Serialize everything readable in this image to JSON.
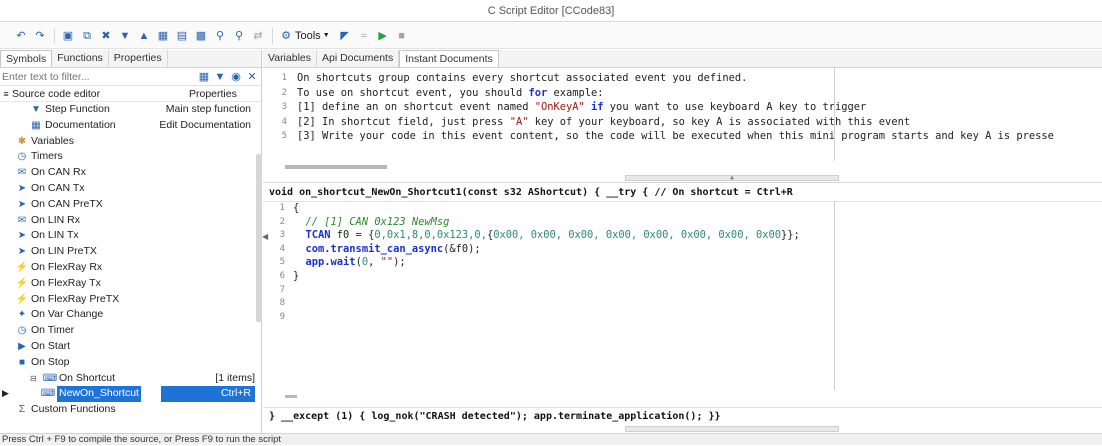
{
  "window": {
    "title": "C Script Editor [CCode83]"
  },
  "toolbar": {
    "tools_label": "Tools"
  },
  "left_tabs": [
    "Symbols",
    "Functions",
    "Properties"
  ],
  "filter": {
    "placeholder": "Enter text to filter..."
  },
  "tree_header": {
    "name": "Source code editor",
    "value": "Properties"
  },
  "tree": [
    {
      "label": "Step Function",
      "value": "Main step function",
      "icon": "step-function-icon"
    },
    {
      "label": "Documentation",
      "value": "Edit Documentation",
      "icon": "documentation-icon"
    },
    {
      "label": "Variables",
      "value": "",
      "icon": "variables-icon"
    },
    {
      "label": "Timers",
      "value": "",
      "icon": "timer-icon"
    },
    {
      "label": "On CAN Rx",
      "value": "",
      "icon": "envelope-icon"
    },
    {
      "label": "On CAN Tx",
      "value": "",
      "icon": "send-icon"
    },
    {
      "label": "On CAN PreTX",
      "value": "",
      "icon": "send-icon"
    },
    {
      "label": "On LIN Rx",
      "value": "",
      "icon": "envelope-icon"
    },
    {
      "label": "On LIN Tx",
      "value": "",
      "icon": "send-icon"
    },
    {
      "label": "On LIN PreTX",
      "value": "",
      "icon": "send-icon"
    },
    {
      "label": "On FlexRay Rx",
      "value": "",
      "icon": "flexray-icon"
    },
    {
      "label": "On FlexRay Tx",
      "value": "",
      "icon": "flexray-icon"
    },
    {
      "label": "On FlexRay PreTX",
      "value": "",
      "icon": "flexray-icon"
    },
    {
      "label": "On Var Change",
      "value": "",
      "icon": "var-change-icon"
    },
    {
      "label": "On Timer",
      "value": "",
      "icon": "timer-icon"
    },
    {
      "label": "On Start",
      "value": "",
      "icon": "play-icon"
    },
    {
      "label": "On Stop",
      "value": "",
      "icon": "stop-icon"
    },
    {
      "label": "On Shortcut",
      "value": "[1 items]",
      "icon": "keyboard-icon"
    },
    {
      "label": "NewOn_Shortcut",
      "value": "Ctrl+R",
      "icon": "keyboard-icon"
    },
    {
      "label": "Custom Functions",
      "value": "",
      "icon": "sigma-icon"
    }
  ],
  "right_tabs": [
    "Variables",
    "Api Documents",
    "Instant Documents"
  ],
  "doc_lines": [
    {
      "n": "1",
      "parts": [
        {
          "t": "On shortcuts group contains every shortcut associated event you defined.",
          "c": ""
        }
      ]
    },
    {
      "n": "2",
      "parts": [
        {
          "t": "To use on shortcut event, you should ",
          "c": ""
        },
        {
          "t": "for",
          "c": "kw"
        },
        {
          "t": " example:",
          "c": ""
        }
      ]
    },
    {
      "n": "3",
      "parts": [
        {
          "t": "[1] define an on shortcut event named ",
          "c": ""
        },
        {
          "t": "\"OnKeyA\"",
          "c": "str"
        },
        {
          "t": " ",
          "c": ""
        },
        {
          "t": "if",
          "c": "kw"
        },
        {
          "t": " you want to use keyboard A key to trigger",
          "c": ""
        }
      ]
    },
    {
      "n": "4",
      "parts": [
        {
          "t": "[2] In shortcut field, just press ",
          "c": ""
        },
        {
          "t": "\"A\"",
          "c": "str"
        },
        {
          "t": " key of your keyboard, so key A is associated with this event",
          "c": ""
        }
      ]
    },
    {
      "n": "5",
      "parts": [
        {
          "t": "[3] Write your code in this event content, so the code will be executed when this mini program starts and key A is presse",
          "c": ""
        }
      ]
    }
  ],
  "code_header": "void on_shortcut_NewOn_Shortcut1(const s32 AShortcut) { __try { // On shortcut = Ctrl+R",
  "code_lines": [
    {
      "n": "1",
      "parts": [
        {
          "t": "{",
          "c": ""
        }
      ]
    },
    {
      "n": "2",
      "parts": [
        {
          "t": "  // [1] CAN 0x123 NewMsg",
          "c": "cm"
        }
      ]
    },
    {
      "n": "3",
      "parts": [
        {
          "t": "  TCAN",
          "c": "fn"
        },
        {
          "t": " f0 = {",
          "c": ""
        },
        {
          "t": "0,0x1,8,0,0x123,0,",
          "c": "num"
        },
        {
          "t": "{",
          "c": ""
        },
        {
          "t": "0x00, 0x00, 0x00, 0x00, 0x00, 0x00, 0x00, 0x00",
          "c": "num"
        },
        {
          "t": "}};",
          "c": ""
        }
      ]
    },
    {
      "n": "4",
      "parts": [
        {
          "t": "  com.transmit_can_async",
          "c": "fn"
        },
        {
          "t": "(&f0);",
          "c": ""
        }
      ]
    },
    {
      "n": "5",
      "parts": [
        {
          "t": "  app.wait",
          "c": "fn"
        },
        {
          "t": "(",
          "c": ""
        },
        {
          "t": "0",
          "c": "num"
        },
        {
          "t": ", ",
          "c": ""
        },
        {
          "t": "\"\"",
          "c": "str"
        },
        {
          "t": ");",
          "c": ""
        }
      ]
    },
    {
      "n": "6",
      "parts": [
        {
          "t": "}",
          "c": ""
        }
      ]
    },
    {
      "n": "7",
      "parts": [
        {
          "t": "",
          "c": ""
        }
      ]
    },
    {
      "n": "8",
      "parts": [
        {
          "t": "",
          "c": ""
        }
      ]
    },
    {
      "n": "9",
      "parts": [
        {
          "t": "",
          "c": ""
        }
      ]
    }
  ],
  "code_footer": "} __except (1) { log_nok(\"CRASH detected\"); app.terminate_application(); }}",
  "status": "Press Ctrl + F9 to compile the source, or Press F9 to run the script"
}
